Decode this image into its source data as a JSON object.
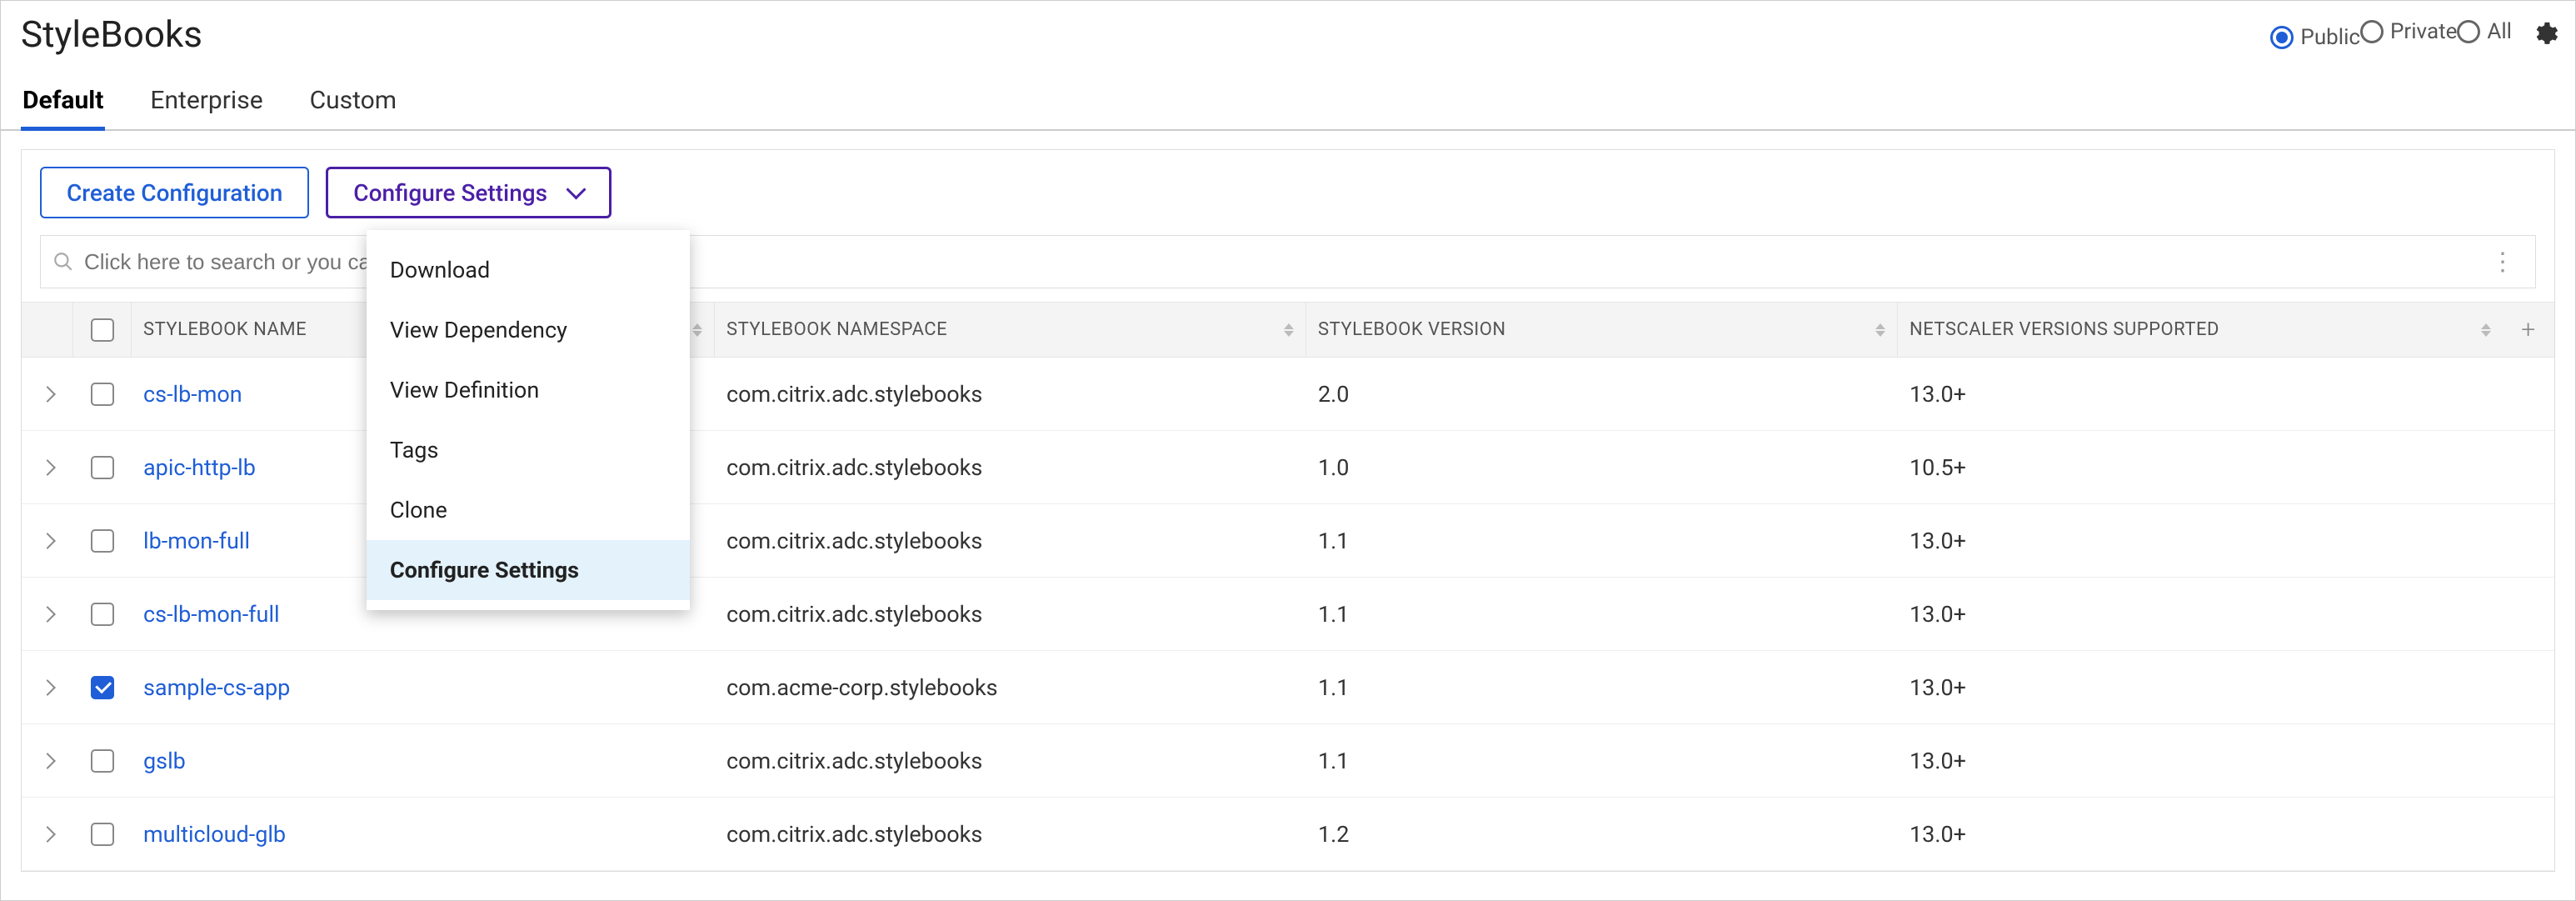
{
  "title": "StyleBooks",
  "filter": {
    "options": [
      {
        "label": "Public",
        "selected": true
      },
      {
        "label": "Private",
        "selected": false
      },
      {
        "label": "All",
        "selected": false
      }
    ]
  },
  "tabs": [
    {
      "label": "Default",
      "active": true
    },
    {
      "label": "Enterprise",
      "active": false
    },
    {
      "label": "Custom",
      "active": false
    }
  ],
  "toolbar": {
    "create_label": "Create Configuration",
    "dropdown_label": "Configure Settings"
  },
  "dropdown_menu": {
    "items": [
      {
        "label": "Download",
        "highlight": false
      },
      {
        "label": "View Dependency",
        "highlight": false
      },
      {
        "label": "View Definition",
        "highlight": false
      },
      {
        "label": "Tags",
        "highlight": false
      },
      {
        "label": "Clone",
        "highlight": false
      },
      {
        "label": "Configure Settings",
        "highlight": true
      }
    ]
  },
  "search": {
    "placeholder": "Click here to search or you can enter Key : Value format"
  },
  "columns": {
    "name": "STYLEBOOK NAME",
    "namespace": "STYLEBOOK NAMESPACE",
    "version": "STYLEBOOK VERSION",
    "supported": "NETSCALER VERSIONS SUPPORTED"
  },
  "rows": [
    {
      "name": "cs-lb-mon",
      "namespace": "com.citrix.adc.stylebooks",
      "version": "2.0",
      "supported": "13.0+",
      "checked": false
    },
    {
      "name": "apic-http-lb",
      "namespace": "com.citrix.adc.stylebooks",
      "version": "1.0",
      "supported": "10.5+",
      "checked": false
    },
    {
      "name": "lb-mon-full",
      "namespace": "com.citrix.adc.stylebooks",
      "version": "1.1",
      "supported": "13.0+",
      "checked": false
    },
    {
      "name": "cs-lb-mon-full",
      "namespace": "com.citrix.adc.stylebooks",
      "version": "1.1",
      "supported": "13.0+",
      "checked": false
    },
    {
      "name": "sample-cs-app",
      "namespace": "com.acme-corp.stylebooks",
      "version": "1.1",
      "supported": "13.0+",
      "checked": true
    },
    {
      "name": "gslb",
      "namespace": "com.citrix.adc.stylebooks",
      "version": "1.1",
      "supported": "13.0+",
      "checked": false
    },
    {
      "name": "multicloud-glb",
      "namespace": "com.citrix.adc.stylebooks",
      "version": "1.2",
      "supported": "13.0+",
      "checked": false
    }
  ]
}
